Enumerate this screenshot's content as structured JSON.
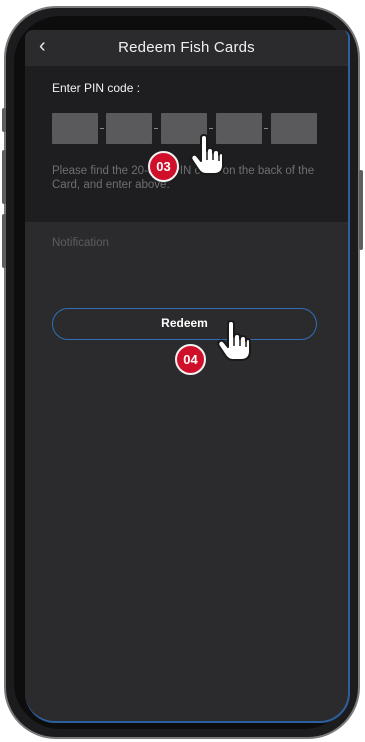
{
  "header": {
    "back_icon": "chevron-left-icon",
    "back_glyph": "‹",
    "title": "Redeem Fish Cards"
  },
  "pin": {
    "label": "Enter PIN code :",
    "box_count": 5,
    "hint": "Please find the 20-digit PIN code on the back of the Card, and enter above."
  },
  "notification": {
    "label": "Notification"
  },
  "redeem": {
    "label": "Redeem"
  },
  "steps": {
    "pin_step": "03",
    "redeem_step": "04"
  },
  "colors": {
    "screen_bg": "#2b2b2d",
    "panel_bg": "#1e1e20",
    "pin_box": "#5a5a5c",
    "accent_border": "#2e6fb8",
    "badge_red": "#d0102a"
  },
  "icons": {
    "pointer": "hand-pointer-icon"
  }
}
